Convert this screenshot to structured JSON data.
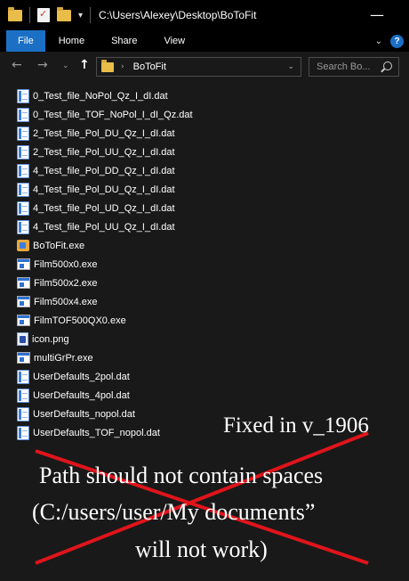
{
  "window": {
    "title_path": "C:\\Users\\Alexey\\Desktop\\BoToFit",
    "minimize_glyph": "—",
    "quick_access_arrow": "▾"
  },
  "ribbon": {
    "tabs": [
      "File",
      "Home",
      "Share",
      "View"
    ],
    "expand_glyph": "⌄",
    "help_glyph": "?"
  },
  "nav": {
    "back_glyph": "←",
    "forward_glyph": "→",
    "recent_glyph": "⌄",
    "up_glyph": "↑",
    "breadcrumb_separator": "›",
    "breadcrumb": "BoToFit",
    "address_dropdown_glyph": "⌄",
    "search_placeholder": "Search Bo..."
  },
  "files": [
    {
      "name": "0_Test_file_NoPol_Qz_I_dI.dat",
      "icon": "dat-file-icon"
    },
    {
      "name": "0_Test_file_TOF_NoPol_I_dI_Qz.dat",
      "icon": "dat-file-icon"
    },
    {
      "name": "2_Test_file_Pol_DU_Qz_I_dI.dat",
      "icon": "dat-file-icon"
    },
    {
      "name": "2_Test_file_Pol_UU_Qz_I_dI.dat",
      "icon": "dat-file-icon"
    },
    {
      "name": "4_Test_file_Pol_DD_Qz_I_dI.dat",
      "icon": "dat-file-icon"
    },
    {
      "name": "4_Test_file_Pol_DU_Qz_I_dI.dat",
      "icon": "dat-file-icon"
    },
    {
      "name": "4_Test_file_Pol_UD_Qz_I_dI.dat",
      "icon": "dat-file-icon"
    },
    {
      "name": "4_Test_file_Pol_UU_Qz_I_dI.dat",
      "icon": "dat-file-icon"
    },
    {
      "name": "BoToFit.exe",
      "icon": "app-exe-icon"
    },
    {
      "name": "Film500x0.exe",
      "icon": "exe-file-icon"
    },
    {
      "name": "Film500x2.exe",
      "icon": "exe-file-icon"
    },
    {
      "name": "Film500x4.exe",
      "icon": "exe-file-icon"
    },
    {
      "name": "FilmTOF500QX0.exe",
      "icon": "exe-file-icon"
    },
    {
      "name": "icon.png",
      "icon": "png-file-icon"
    },
    {
      "name": "multiGrPr.exe",
      "icon": "exe-file-icon"
    },
    {
      "name": "UserDefaults_2pol.dat",
      "icon": "dat-file-icon"
    },
    {
      "name": "UserDefaults_4pol.dat",
      "icon": "dat-file-icon"
    },
    {
      "name": "UserDefaults_nopol.dat",
      "icon": "dat-file-icon"
    },
    {
      "name": "UserDefaults_TOF_nopol.dat",
      "icon": "dat-file-icon"
    }
  ],
  "annotation": {
    "fixed_note": "Fixed in v_1906",
    "warning_lines": [
      "Path should not contain spaces",
      "(C:/users/user/My documents”",
      "will not work)"
    ],
    "cross_color": "#e0141b"
  }
}
